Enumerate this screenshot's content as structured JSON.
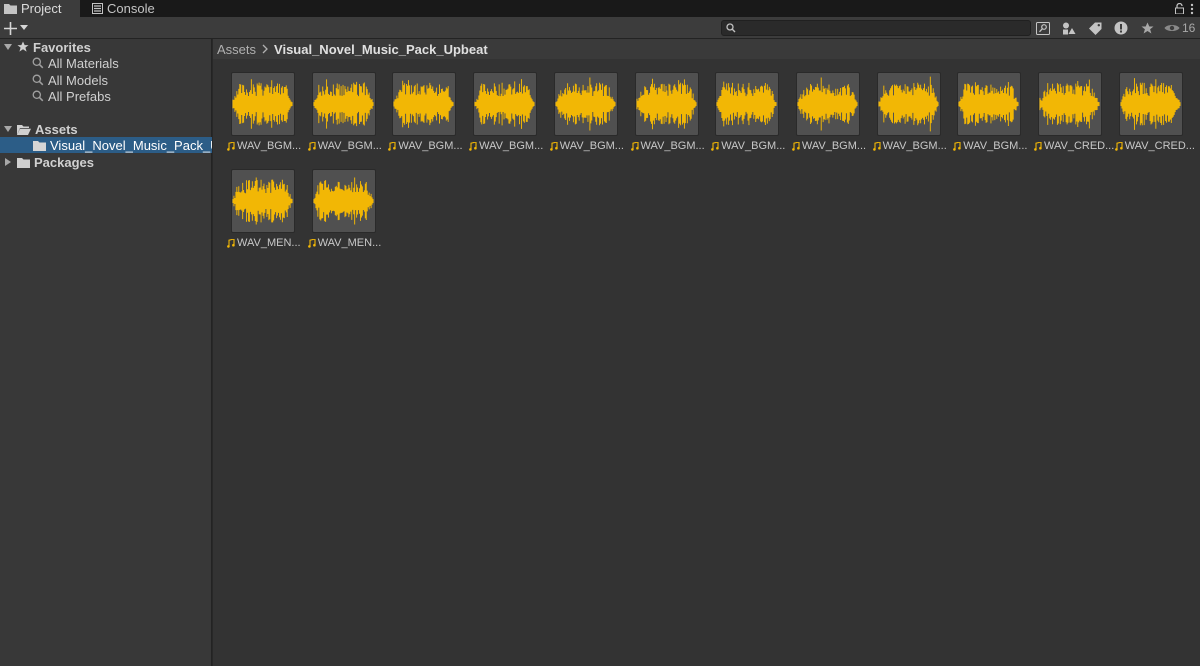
{
  "tabs": [
    {
      "label": "Project",
      "icon": "folder-icon"
    },
    {
      "label": "Console",
      "icon": "console-icon"
    }
  ],
  "toolbar": {
    "add_label": "+",
    "search_placeholder": "",
    "hidden_count": "16"
  },
  "sidebar": {
    "favorites_label": "Favorites",
    "favorites_items": [
      "All Materials",
      "All Models",
      "All Prefabs"
    ],
    "assets_label": "Assets",
    "selected_folder": "Visual_Novel_Music_Pack_Upbeat",
    "packages_label": "Packages"
  },
  "breadcrumb": {
    "root": "Assets",
    "current": "Visual_Novel_Music_Pack_Upbeat"
  },
  "accent_color": "#f2b705",
  "assets": [
    {
      "label": "WAV_BGM..."
    },
    {
      "label": "WAV_BGM..."
    },
    {
      "label": "WAV_BGM..."
    },
    {
      "label": "WAV_BGM..."
    },
    {
      "label": "WAV_BGM..."
    },
    {
      "label": "WAV_BGM..."
    },
    {
      "label": "WAV_BGM..."
    },
    {
      "label": "WAV_BGM..."
    },
    {
      "label": "WAV_BGM..."
    },
    {
      "label": "WAV_BGM..."
    },
    {
      "label": "WAV_CRED..."
    },
    {
      "label": "WAV_CRED..."
    },
    {
      "label": "WAV_MEN..."
    },
    {
      "label": "WAV_MEN..."
    }
  ]
}
